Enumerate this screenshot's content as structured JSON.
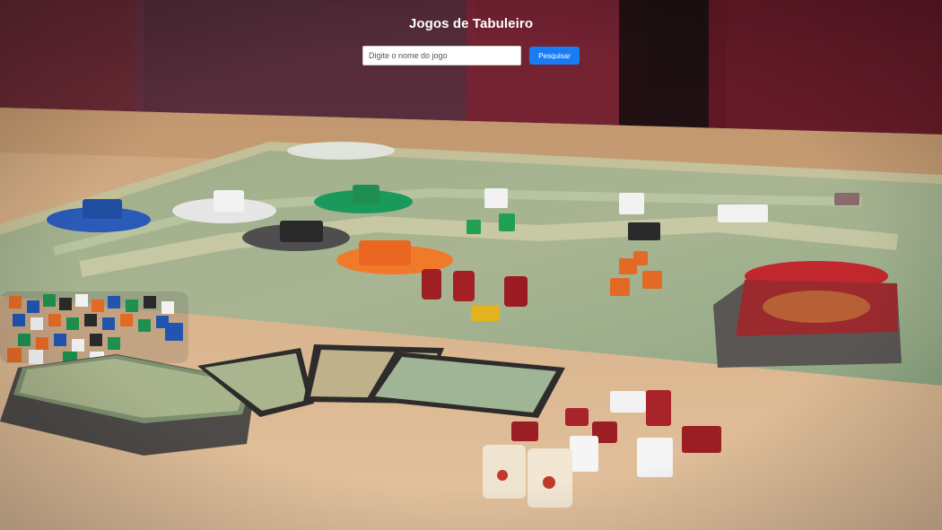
{
  "header": {
    "title": "Jogos de Tabuleiro"
  },
  "search": {
    "placeholder": "Digite o nome do jogo",
    "value": "",
    "button_label": "Pesquisar"
  },
  "colors": {
    "button_bg": "#1a7cf5",
    "title_text": "#ffffff"
  },
  "background": {
    "icon": "board-game-photo"
  }
}
